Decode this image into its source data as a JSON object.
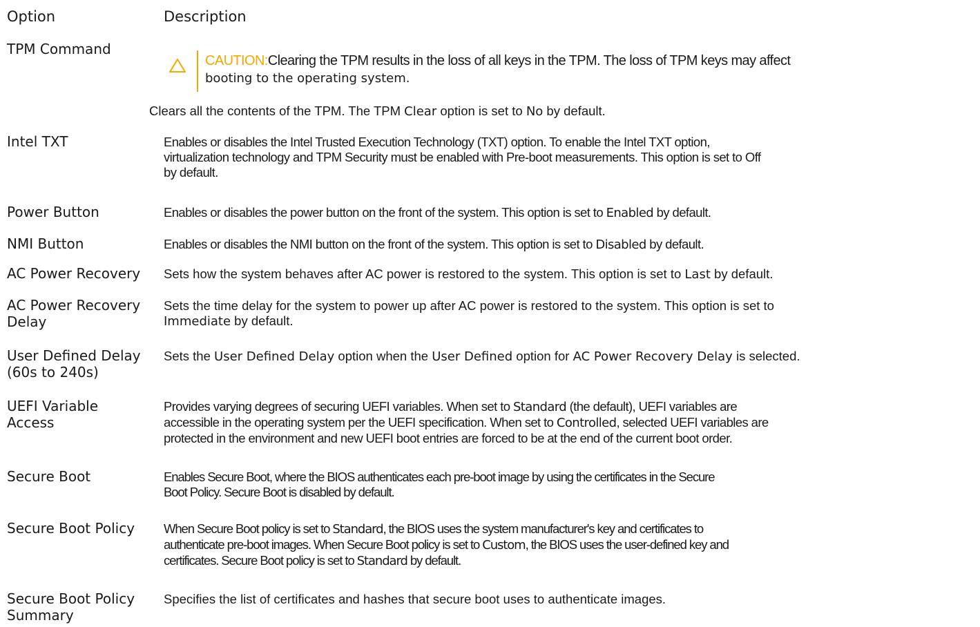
{
  "header": {
    "option": "Option",
    "description": "Description"
  },
  "tpm": {
    "label": "TPM Command",
    "caution_label": "CAUTION:",
    "caution_line1": "Clearing the TPM results in the loss of all keys in the TPM. The loss of TPM keys may affect",
    "caution_line2": "booting to the operating system.",
    "desc_pre": "Clears all the contents of the TPM. The TPM ",
    "desc_clear": "Clear",
    "desc_mid": " option is set to ",
    "desc_no": "No",
    "desc_post": " by default."
  },
  "intel_txt": {
    "label": "Intel TXT",
    "line1": "Enables or disables the Intel Trusted Execution Technology (TXT) option. To enable the Intel TXT option,",
    "line2": "virtualization technology and TPM Security must be enabled with Pre-boot measurements. This option is set to Off",
    "line3": "by default."
  },
  "power_button": {
    "label": "Power Button",
    "pre": "Enables or disables the power button on the front of the system. This option is set to ",
    "value": "Enabled",
    "post": " by default."
  },
  "nmi_button": {
    "label": "NMI Button",
    "pre": "Enables or disables the NMI button on the front of the system. This option is set to ",
    "value": "Disabled",
    "post": " by default."
  },
  "ac_recovery": {
    "label": "AC Power Recovery",
    "pre": "Sets how the system behaves after AC power is restored to the system. This option is set to ",
    "value": "Last",
    "post": " by default."
  },
  "ac_delay": {
    "label1": "AC Power Recovery",
    "label2": "Delay",
    "line1": "Sets the time delay for the system to power up after AC power is restored to the system. This option is set to",
    "value": "Immediate",
    "post": " by default."
  },
  "user_delay": {
    "label1": "User Defined Delay",
    "label2": "(60s to 240s)",
    "t1": "Sets the ",
    "v1": "User Defined Delay",
    "t2": " option when the ",
    "v2": "User Defined",
    "t3": " option for ",
    "v3": "AC Power Recovery Delay",
    "t4": " is selected."
  },
  "uefi_access": {
    "label1": "UEFI Variable",
    "label2": "Access",
    "l1_pre": "Provides varying degrees of securing UEFI variables. When set to ",
    "l1_value": "Standard",
    "l1_post": " (the default), UEFI variables are",
    "l2_pre": "accessible in the operating system per the UEFI specification. When set to ",
    "l2_value": "Controlled",
    "l2_post": ", selected UEFI variables are",
    "l3": "protected in the environment and new UEFI boot entries are forced to be at the end of the current boot order."
  },
  "secure_boot": {
    "label": "Secure Boot",
    "line1": "Enables Secure Boot, where the BIOS authenticates each pre-boot image by using the certificates in the Secure",
    "line2": "Boot Policy. Secure Boot is disabled by default."
  },
  "secure_boot_policy": {
    "label": "Secure Boot Policy",
    "l1_pre": "When Secure Boot policy is set to ",
    "l1_value": "Standard",
    "l1_post": ", the BIOS uses the system manufacturer's key and certificates to",
    "l2_pre": "authenticate pre-boot images. When Secure Boot policy is set to ",
    "l2_value": "Custom",
    "l2_post": ", the BIOS uses the user-defined key and",
    "l3_pre": "certificates. Secure Boot policy is set to ",
    "l3_value": "Standard",
    "l3_post": " by default."
  },
  "policy_summary": {
    "label1": "Secure Boot Policy",
    "label2": "Summary",
    "line1": "Specifies the list of certificates and hashes that secure boot uses to authenticate images."
  },
  "colors": {
    "caution": "#f5a800",
    "text": "#1a1a1a"
  },
  "icons": {
    "caution": "warning-triangle-icon"
  }
}
